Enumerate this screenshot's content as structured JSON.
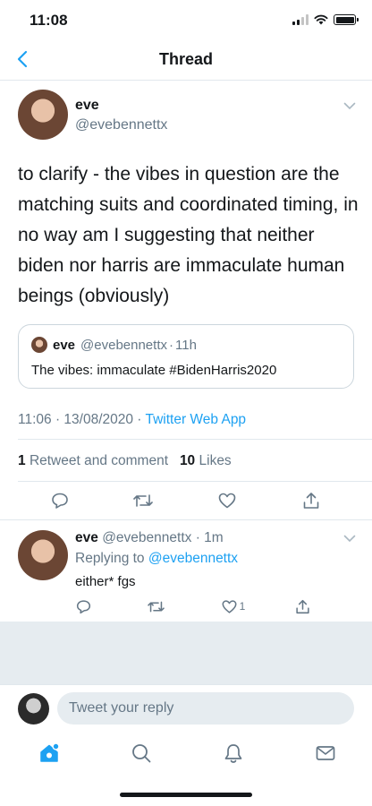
{
  "status_bar": {
    "time": "11:08"
  },
  "header": {
    "title": "Thread"
  },
  "main_tweet": {
    "name": "eve",
    "handle": "@evebennettx",
    "text": "to clarify - the vibes in question are the matching suits and coordinated timing, in no way am I suggesting that neither biden nor harris are immaculate human beings (obviously)",
    "quoted": {
      "name": "eve",
      "handle": "@evebennettx",
      "time": "11h",
      "text": "The vibes: immaculate #BidenHarris2020"
    },
    "timestamp": "11:06 · 13/08/2020 · ",
    "source": "Twitter Web App",
    "retweets_count": "1",
    "retweets_label": "Retweet and comment",
    "likes_count": "10",
    "likes_label": "Likes"
  },
  "reply_tweet": {
    "name": "eve",
    "handle": "@evebennettx",
    "time": "1m",
    "replying_prefix": "Replying to ",
    "replying_to": "@evebennettx",
    "text": "either* fgs",
    "like_count": "1"
  },
  "compose": {
    "placeholder": "Tweet your reply"
  },
  "colors": {
    "accent": "#1da1f2",
    "muted": "#657786",
    "divider": "#e1e8ed",
    "gray_bg": "#e6ecf0"
  },
  "icons": [
    "back-chevron-icon",
    "dropdown-chevron-icon",
    "reply-icon",
    "retweet-icon",
    "like-icon",
    "share-icon",
    "home-icon",
    "search-icon",
    "notifications-icon",
    "messages-icon"
  ]
}
